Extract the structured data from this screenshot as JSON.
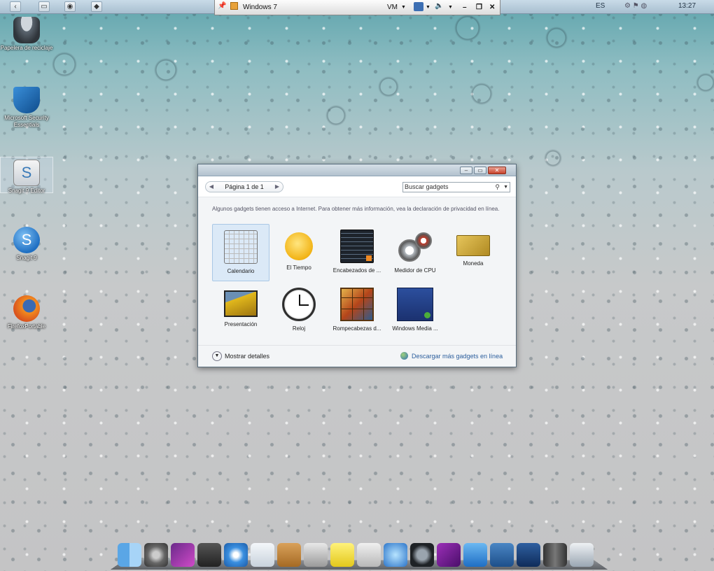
{
  "host_bar": {
    "window_title": "Windows 7",
    "vm_label": "VM",
    "language": "ES",
    "clock": "13:27"
  },
  "desktop_icons": [
    {
      "label": "Papelera de reciclaje",
      "icon": "recycle-bin-icon"
    },
    {
      "label": "Microsoft Security Essentials",
      "icon": "security-shield-icon"
    },
    {
      "label": "Snagit 9 Editor",
      "icon": "snagit-editor-icon"
    },
    {
      "label": "Snagit 9",
      "icon": "snagit-icon"
    },
    {
      "label": "FirefoxPortable",
      "icon": "firefox-icon"
    }
  ],
  "gadgets_window": {
    "pager": "Página 1 de 1",
    "search_placeholder": "Buscar gadgets",
    "info_text": "Algunos gadgets tienen acceso a Internet. Para obtener más información, vea la declaración de privacidad en línea.",
    "gadgets": [
      {
        "label": "Calendario",
        "icon": "calendar-icon",
        "selected": true
      },
      {
        "label": "El Tiempo",
        "icon": "weather-sun-icon"
      },
      {
        "label": "Encabezados de ...",
        "icon": "feed-headlines-icon"
      },
      {
        "label": "Medidor de CPU",
        "icon": "cpu-meter-icon"
      },
      {
        "label": "Moneda",
        "icon": "currency-icon"
      },
      {
        "label": "Presentación",
        "icon": "slideshow-icon"
      },
      {
        "label": "Reloj",
        "icon": "clock-icon"
      },
      {
        "label": "Rompecabezas d...",
        "icon": "puzzle-icon"
      },
      {
        "label": "Windows Media ...",
        "icon": "media-center-icon"
      }
    ],
    "show_details": "Mostrar detalles",
    "download_more": "Descargar más gadgets en línea"
  },
  "dock_items": [
    "finder-icon",
    "system-preferences-icon",
    "front-row-icon",
    "network-icon",
    "safari-icon",
    "mail-icon",
    "address-book-icon",
    "calculator-icon",
    "stickies-icon",
    "text-edit-icon",
    "itunes-icon",
    "quicktime-icon",
    "x-app-icon",
    "app-store-icon",
    "utilities-hammer-icon",
    "eject-icon",
    "trash-icon",
    "dashboard-icon"
  ]
}
